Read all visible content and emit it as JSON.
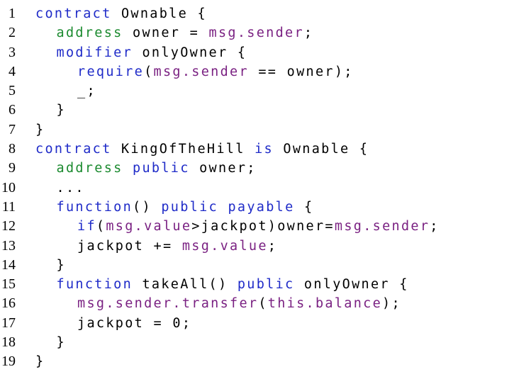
{
  "colors": {
    "keyword": "#1f2bc8",
    "type": "#1b8a2f",
    "global": "#7a2182",
    "plain": "#000000",
    "background": "#ffffff"
  },
  "code_listing": {
    "lines": [
      {
        "number": "1",
        "indent": 0,
        "tokens": [
          {
            "t": "contract",
            "c": "kw"
          },
          {
            "t": " Ownable {",
            "c": "pl"
          }
        ]
      },
      {
        "number": "2",
        "indent": 1,
        "tokens": [
          {
            "t": "address",
            "c": "ty"
          },
          {
            "t": " owner = ",
            "c": "pl"
          },
          {
            "t": "msg.sender",
            "c": "gl"
          },
          {
            "t": ";",
            "c": "pl"
          }
        ]
      },
      {
        "number": "3",
        "indent": 1,
        "tokens": [
          {
            "t": "modifier",
            "c": "kw"
          },
          {
            "t": " onlyOwner {",
            "c": "pl"
          }
        ]
      },
      {
        "number": "4",
        "indent": 2,
        "tokens": [
          {
            "t": "require",
            "c": "kw"
          },
          {
            "t": "(",
            "c": "pl"
          },
          {
            "t": "msg.sender",
            "c": "gl"
          },
          {
            "t": " == owner);",
            "c": "pl"
          }
        ]
      },
      {
        "number": "5",
        "indent": 2,
        "tokens": [
          {
            "t": "_;",
            "c": "pl"
          }
        ]
      },
      {
        "number": "6",
        "indent": 1,
        "tokens": [
          {
            "t": "}",
            "c": "pl"
          }
        ]
      },
      {
        "number": "7",
        "indent": 0,
        "tokens": [
          {
            "t": "}",
            "c": "pl"
          }
        ]
      },
      {
        "number": "8",
        "indent": 0,
        "tokens": [
          {
            "t": "contract",
            "c": "kw"
          },
          {
            "t": " KingOfTheHill ",
            "c": "pl"
          },
          {
            "t": "is",
            "c": "kw"
          },
          {
            "t": " Ownable {",
            "c": "pl"
          }
        ]
      },
      {
        "number": "9",
        "indent": 1,
        "tokens": [
          {
            "t": "address",
            "c": "ty"
          },
          {
            "t": " ",
            "c": "pl"
          },
          {
            "t": "public",
            "c": "kw"
          },
          {
            "t": " owner;",
            "c": "pl"
          }
        ]
      },
      {
        "number": "10",
        "indent": 1,
        "tokens": [
          {
            "t": "...",
            "c": "pl"
          }
        ]
      },
      {
        "number": "11",
        "indent": 1,
        "tokens": [
          {
            "t": "function",
            "c": "kw"
          },
          {
            "t": "() ",
            "c": "pl"
          },
          {
            "t": "public",
            "c": "kw"
          },
          {
            "t": " ",
            "c": "pl"
          },
          {
            "t": "payable",
            "c": "kw"
          },
          {
            "t": " {",
            "c": "pl"
          }
        ]
      },
      {
        "number": "12",
        "indent": 2,
        "tokens": [
          {
            "t": "if",
            "c": "kw"
          },
          {
            "t": "(",
            "c": "pl"
          },
          {
            "t": "msg.value",
            "c": "gl"
          },
          {
            "t": ">jackpot)owner=",
            "c": "pl"
          },
          {
            "t": "msg.sender",
            "c": "gl"
          },
          {
            "t": ";",
            "c": "pl"
          }
        ]
      },
      {
        "number": "13",
        "indent": 2,
        "tokens": [
          {
            "t": "jackpot += ",
            "c": "pl"
          },
          {
            "t": "msg.value",
            "c": "gl"
          },
          {
            "t": ";",
            "c": "pl"
          }
        ]
      },
      {
        "number": "14",
        "indent": 1,
        "tokens": [
          {
            "t": "}",
            "c": "pl"
          }
        ]
      },
      {
        "number": "15",
        "indent": 1,
        "tokens": [
          {
            "t": "function",
            "c": "kw"
          },
          {
            "t": " takeAll() ",
            "c": "pl"
          },
          {
            "t": "public",
            "c": "kw"
          },
          {
            "t": " onlyOwner {",
            "c": "pl"
          }
        ]
      },
      {
        "number": "16",
        "indent": 2,
        "tokens": [
          {
            "t": "msg.sender.transfer",
            "c": "gl"
          },
          {
            "t": "(",
            "c": "pl"
          },
          {
            "t": "this.balance",
            "c": "gl"
          },
          {
            "t": ");",
            "c": "pl"
          }
        ]
      },
      {
        "number": "17",
        "indent": 2,
        "tokens": [
          {
            "t": "jackpot = 0;",
            "c": "pl"
          }
        ]
      },
      {
        "number": "18",
        "indent": 1,
        "tokens": [
          {
            "t": "}",
            "c": "pl"
          }
        ]
      },
      {
        "number": "19",
        "indent": 0,
        "tokens": [
          {
            "t": "}",
            "c": "pl"
          }
        ]
      }
    ]
  }
}
